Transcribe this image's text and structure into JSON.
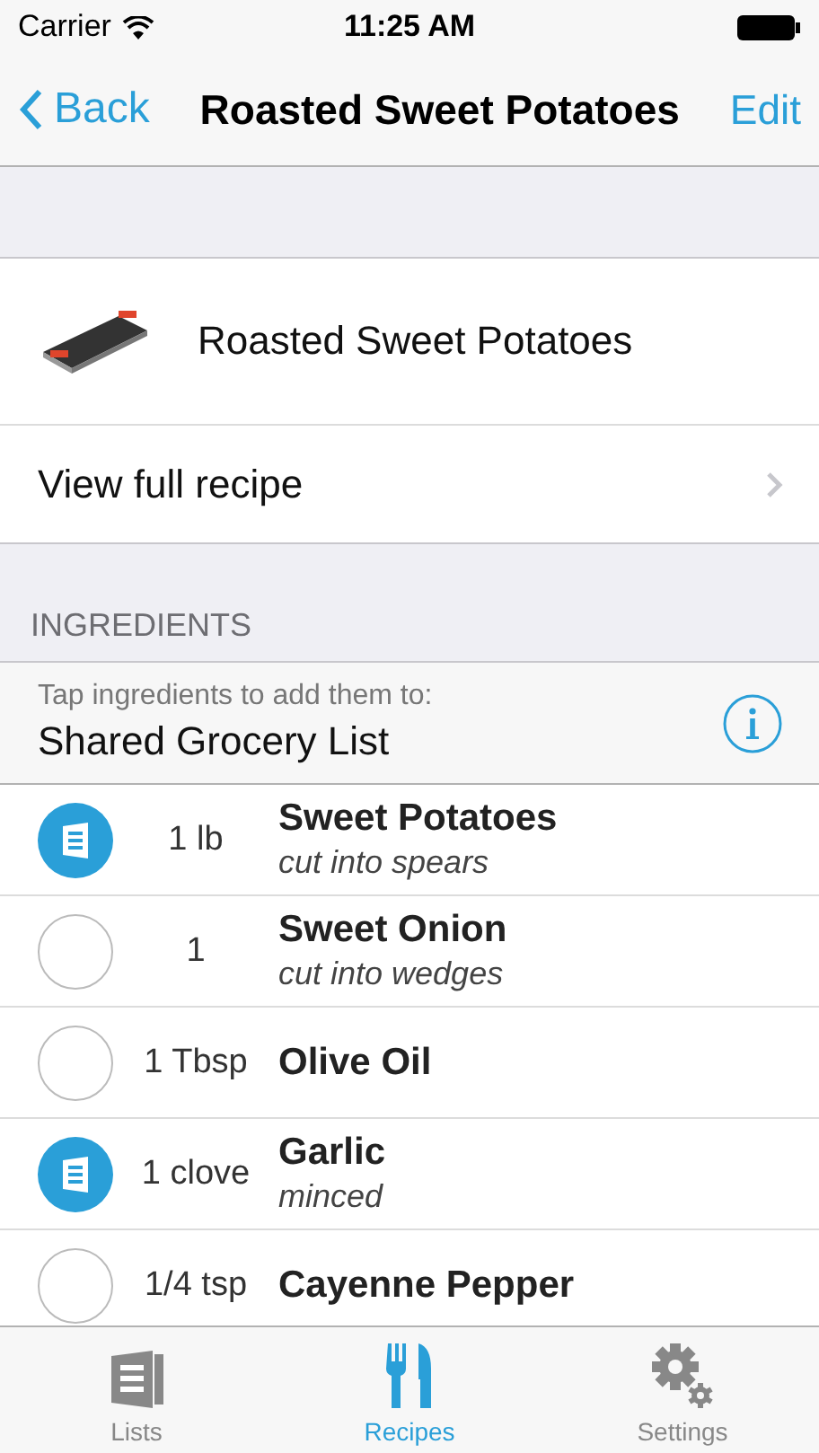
{
  "status_bar": {
    "carrier": "Carrier",
    "time": "11:25 AM"
  },
  "nav": {
    "back": "Back",
    "title": "Roasted Sweet Potatoes",
    "action": "Edit"
  },
  "recipe": {
    "name": "Roasted Sweet Potatoes",
    "link": "View full recipe"
  },
  "section_header": "INGREDIENTS",
  "target": {
    "hint": "Tap ingredients to add them to:",
    "list": "Shared Grocery List"
  },
  "ingredients": [
    {
      "qty": "1 lb",
      "name": "Sweet Potatoes",
      "note": "cut into spears",
      "selected": true
    },
    {
      "qty": "1",
      "name": "Sweet Onion",
      "note": "cut into wedges",
      "selected": false
    },
    {
      "qty": "1 Tbsp",
      "name": "Olive Oil",
      "selected": false
    },
    {
      "qty": "1 clove",
      "name": "Garlic",
      "note": "minced",
      "selected": true
    },
    {
      "qty": "1/4 tsp",
      "name": "Cayenne Pepper",
      "selected": false
    }
  ],
  "tabs": [
    {
      "label": "Lists",
      "kind": "lists",
      "selected": false
    },
    {
      "label": "Recipes",
      "kind": "recipes",
      "selected": true
    },
    {
      "label": "Settings",
      "kind": "settings",
      "selected": false
    }
  ]
}
